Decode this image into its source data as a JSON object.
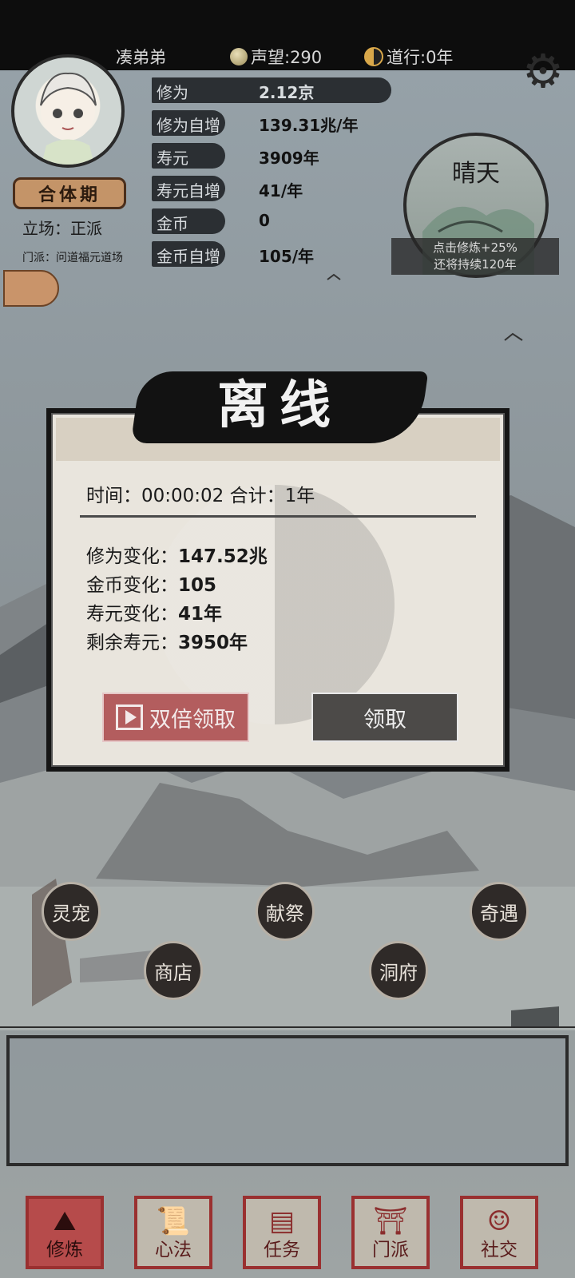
{
  "header": {
    "player_name": "凑弟弟",
    "reputation_label": "声望:290",
    "daoxing_label": "道行:0年",
    "settings_icon": "gear-icon"
  },
  "profile": {
    "rank": "合体期",
    "stance": "立场：正派",
    "sect": "门派：问道福元道场"
  },
  "stats": [
    {
      "label": "修为",
      "value": "2.12京"
    },
    {
      "label": "修为自增",
      "value": "139.31兆/年"
    },
    {
      "label": "寿元",
      "value": "3909年"
    },
    {
      "label": "寿元自增",
      "value": "41/年"
    },
    {
      "label": "金币",
      "value": "0"
    },
    {
      "label": "金币自增",
      "value": "105/年"
    }
  ],
  "weather": {
    "title": "晴天",
    "note_line1": "点击修炼+25%",
    "note_line2": "还将持续120年"
  },
  "offline_dialog": {
    "title": "离线",
    "time_line": "时间：00:00:02  合计：1年",
    "changes": [
      {
        "label": "修为变化：",
        "value": "147.52兆"
      },
      {
        "label": "金币变化：",
        "value": "105"
      },
      {
        "label": "寿元变化：",
        "value": "41年"
      },
      {
        "label": "剩余寿元：",
        "value": "3950年"
      }
    ],
    "double_button": "双倍领取",
    "claim_button": "领取"
  },
  "map_nodes": [
    "灵宠",
    "献祭",
    "奇遇",
    "商店",
    "洞府"
  ],
  "bottom_nav": [
    {
      "label": "修炼",
      "active": true
    },
    {
      "label": "心法",
      "active": false
    },
    {
      "label": "任务",
      "active": false
    },
    {
      "label": "门派",
      "active": false
    },
    {
      "label": "社交",
      "active": false
    }
  ],
  "colors": {
    "accent_red": "#b35d5e",
    "dark_button": "#4c4a48",
    "dialog_bg": "#e9e5dd",
    "sky": "#8e979b"
  }
}
